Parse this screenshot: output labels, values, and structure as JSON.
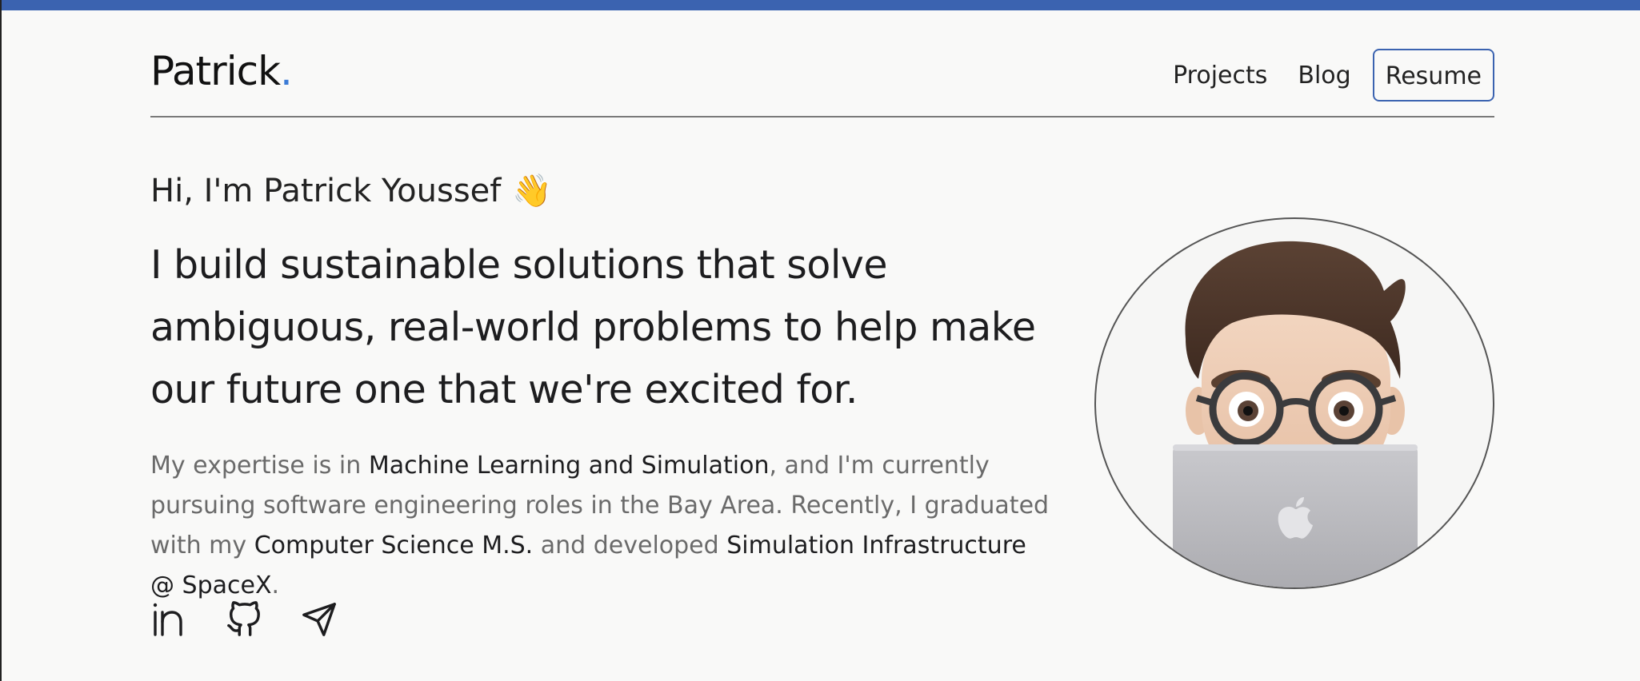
{
  "header": {
    "logo": "Patrick",
    "logo_dot": ".",
    "nav": {
      "projects": "Projects",
      "blog": "Blog",
      "resume": "Resume"
    }
  },
  "hero": {
    "greeting": "Hi, I'm Patrick Youssef",
    "greeting_emoji": "👋",
    "headline": "I build sustainable solutions that solve ambiguous, real-world problems to help make our future one that we're excited for.",
    "bio": {
      "p1": "My expertise is in ",
      "h1": "Machine Learning and Simulation",
      "p2": ", and I'm currently pursuing software engineering roles in the Bay Area. Recently, I graduated with my ",
      "h2": "Computer Science M.S.",
      "p3": " and developed ",
      "h3": "Simulation Infrastructure @ SpaceX",
      "p4": "."
    }
  },
  "socials": [
    {
      "icon": "linkedin-icon"
    },
    {
      "icon": "github-icon"
    },
    {
      "icon": "send-icon"
    }
  ],
  "avatar": {
    "icon": "memoji-avatar-with-laptop"
  },
  "colors": {
    "accent": "#3b63b0",
    "logo_dot": "#3b7bd6",
    "background": "#f9f9f8",
    "muted_text": "#6a6a6a"
  }
}
